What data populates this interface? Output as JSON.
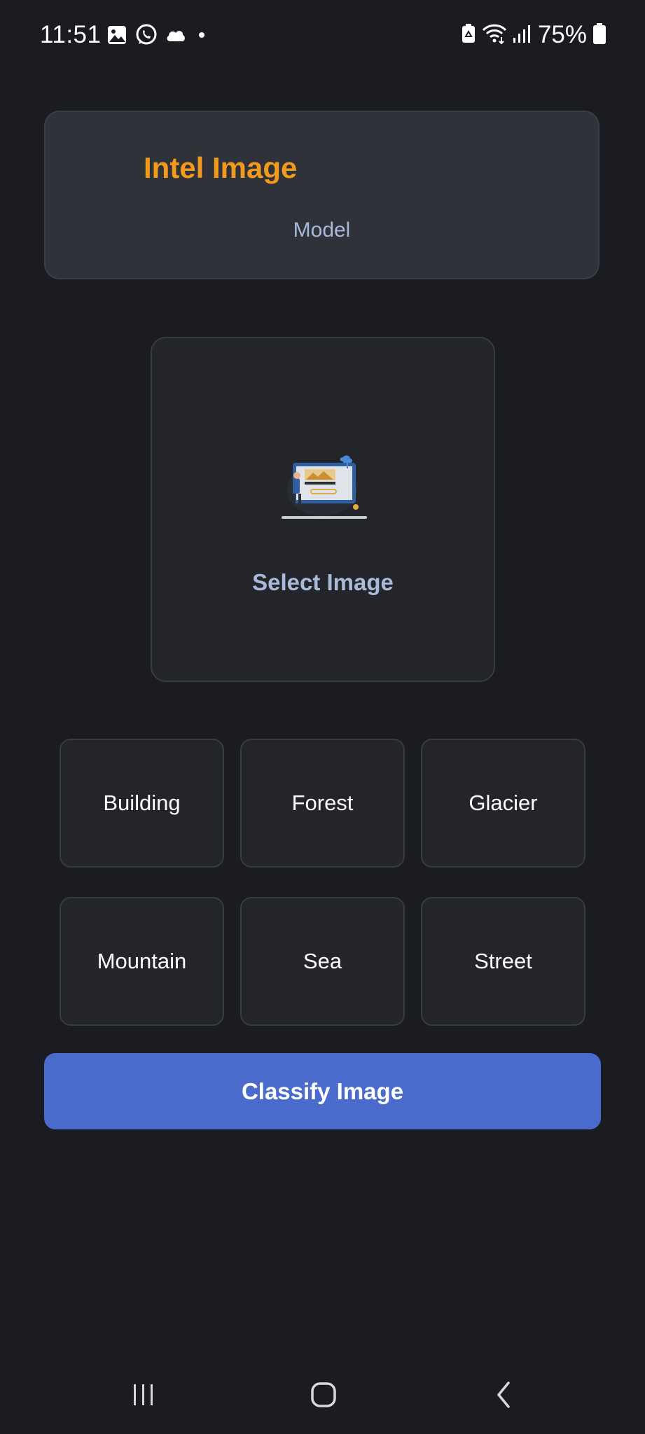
{
  "status_bar": {
    "time": "11:51",
    "battery": "75%",
    "left_icons": [
      "gallery-icon",
      "whatsapp-icon",
      "cloud-icon",
      "dot-icon"
    ],
    "right_icons": [
      "battery-saver-icon",
      "wifi-icon",
      "signal-icon",
      "battery-icon"
    ]
  },
  "header": {
    "title": "Intel Image",
    "subtitle": "Model"
  },
  "select_image": {
    "icon": "image-upload-illustration",
    "label": "Select Image"
  },
  "categories": [
    {
      "label": "Building"
    },
    {
      "label": "Forest"
    },
    {
      "label": "Glacier"
    },
    {
      "label": "Mountain"
    },
    {
      "label": "Sea"
    },
    {
      "label": "Street"
    }
  ],
  "classify_button": {
    "label": "Classify Image"
  },
  "colors": {
    "background": "#1b1c21",
    "header_card": "#30323a",
    "title_accent": "#f29a1d",
    "subtitle_text": "#a8b9d9",
    "card": "#23252b",
    "button_primary": "#4a6bcb"
  },
  "nav_bar": {
    "icons": [
      "recent-apps-icon",
      "home-icon",
      "back-icon"
    ]
  }
}
